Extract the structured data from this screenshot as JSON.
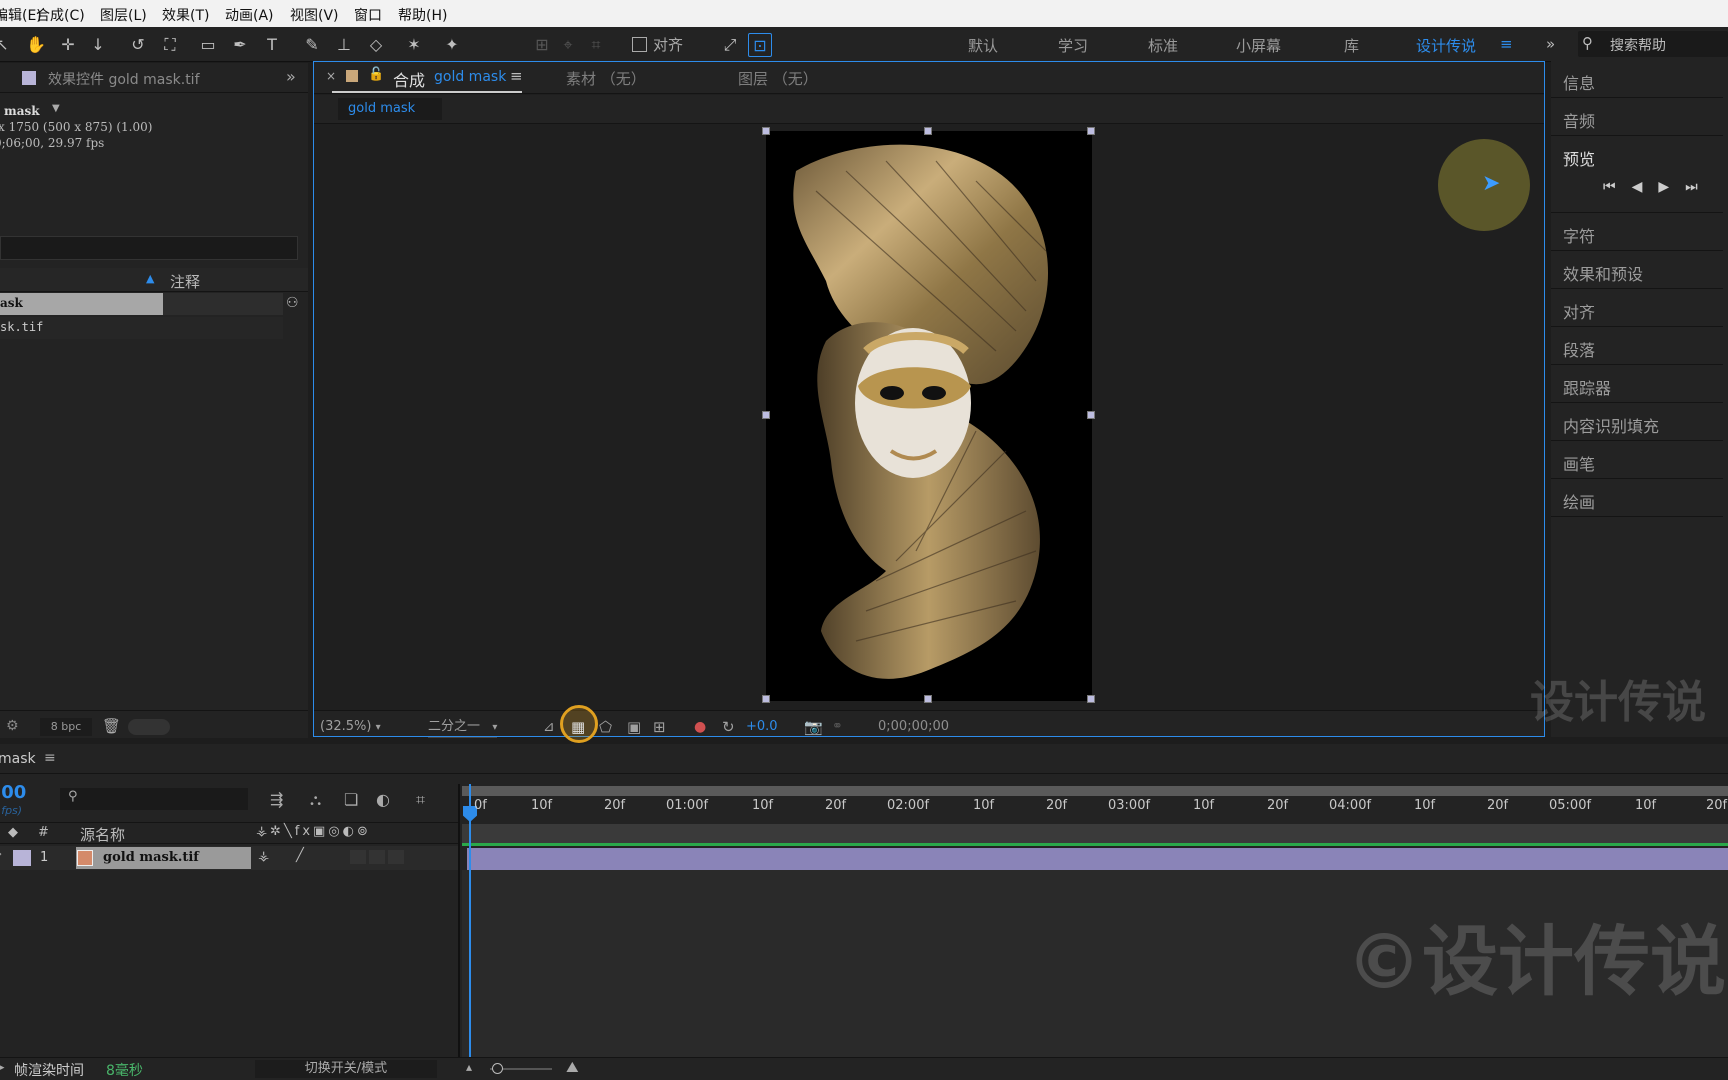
{
  "menu": [
    "编辑(E)",
    "合成(C)",
    "图层(L)",
    "效果(T)",
    "动画(A)",
    "视图(V)",
    "窗口",
    "帮助(H)"
  ],
  "toolbar": {
    "snap_label": "对齐"
  },
  "workspaces": [
    "默认",
    "学习",
    "标准",
    "小屏幕",
    "库",
    "设计传说"
  ],
  "active_workspace": "设计传说",
  "search": {
    "placeholder": "搜索帮助"
  },
  "effects_panel": {
    "title": "效果控件 gold mask.tif",
    "item_name": "mask",
    "dims": "x 1750 (500 x 875) (1.00)",
    "duration": "0;06;00, 29.97 fps",
    "comment_header": "注释",
    "row_selected": "ask",
    "row_file": "sk.tif",
    "bpc": "8 bpc"
  },
  "viewer": {
    "tab_comp_prefix": "合成",
    "tab_comp_name": "gold mask",
    "tab_footage": "素材 （无）",
    "tab_layer": "图层 （无）",
    "breadcrumb": "gold mask",
    "zoom": "(32.5%)",
    "resolution": "二分之一",
    "exposure": "+0.0",
    "timecode": "0;00;00;00"
  },
  "right_panels": [
    "信息",
    "音频",
    "预览",
    "字符",
    "效果和预设",
    "对齐",
    "段落",
    "跟踪器",
    "内容识别填充",
    "画笔",
    "绘画"
  ],
  "timeline": {
    "tab": "mask",
    "current_time": ";00",
    "fps_note": "/ fps)",
    "search_placeholder": "",
    "col_number": "#",
    "col_source": "源名称",
    "layer_index": "1",
    "layer_name": "gold mask.tif",
    "ruler": [
      "0f",
      "10f",
      "20f",
      "01:00f",
      "10f",
      "20f",
      "02:00f",
      "10f",
      "20f",
      "03:00f",
      "10f",
      "20f",
      "04:00f",
      "10f",
      "20f",
      "05:00f",
      "10f",
      "20f"
    ],
    "render_label": "帧渲染时间",
    "render_value": "8毫秒",
    "toggle_label": "切换开关/模式"
  },
  "watermarks": {
    "small": "设计传说",
    "large": "©设计传说"
  },
  "colors": {
    "accent": "#2d8ceb",
    "layer_bar": "#8a84b8",
    "green_bar": "#2aa84a",
    "highlight": "#e0a020"
  }
}
